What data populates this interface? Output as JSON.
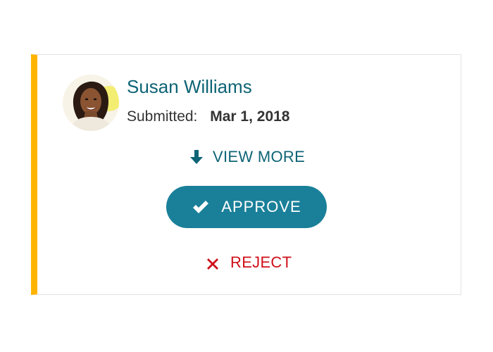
{
  "submission": {
    "name": "Susan Williams",
    "submitted_label": "Submitted:",
    "submitted_date": "Mar 1, 2018"
  },
  "actions": {
    "view_more_label": "VIEW MORE",
    "approve_label": "APPROVE",
    "reject_label": "REJECT"
  },
  "icons": {
    "view_more": "arrow-down-icon",
    "approve": "checkmark-icon",
    "reject": "x-icon"
  },
  "colors": {
    "accent_bar": "#ffb400",
    "name_text": "#0e6475",
    "approve_bg": "#1a8099",
    "reject_text": "#d0101a",
    "card_border": "#e3e3e3"
  }
}
